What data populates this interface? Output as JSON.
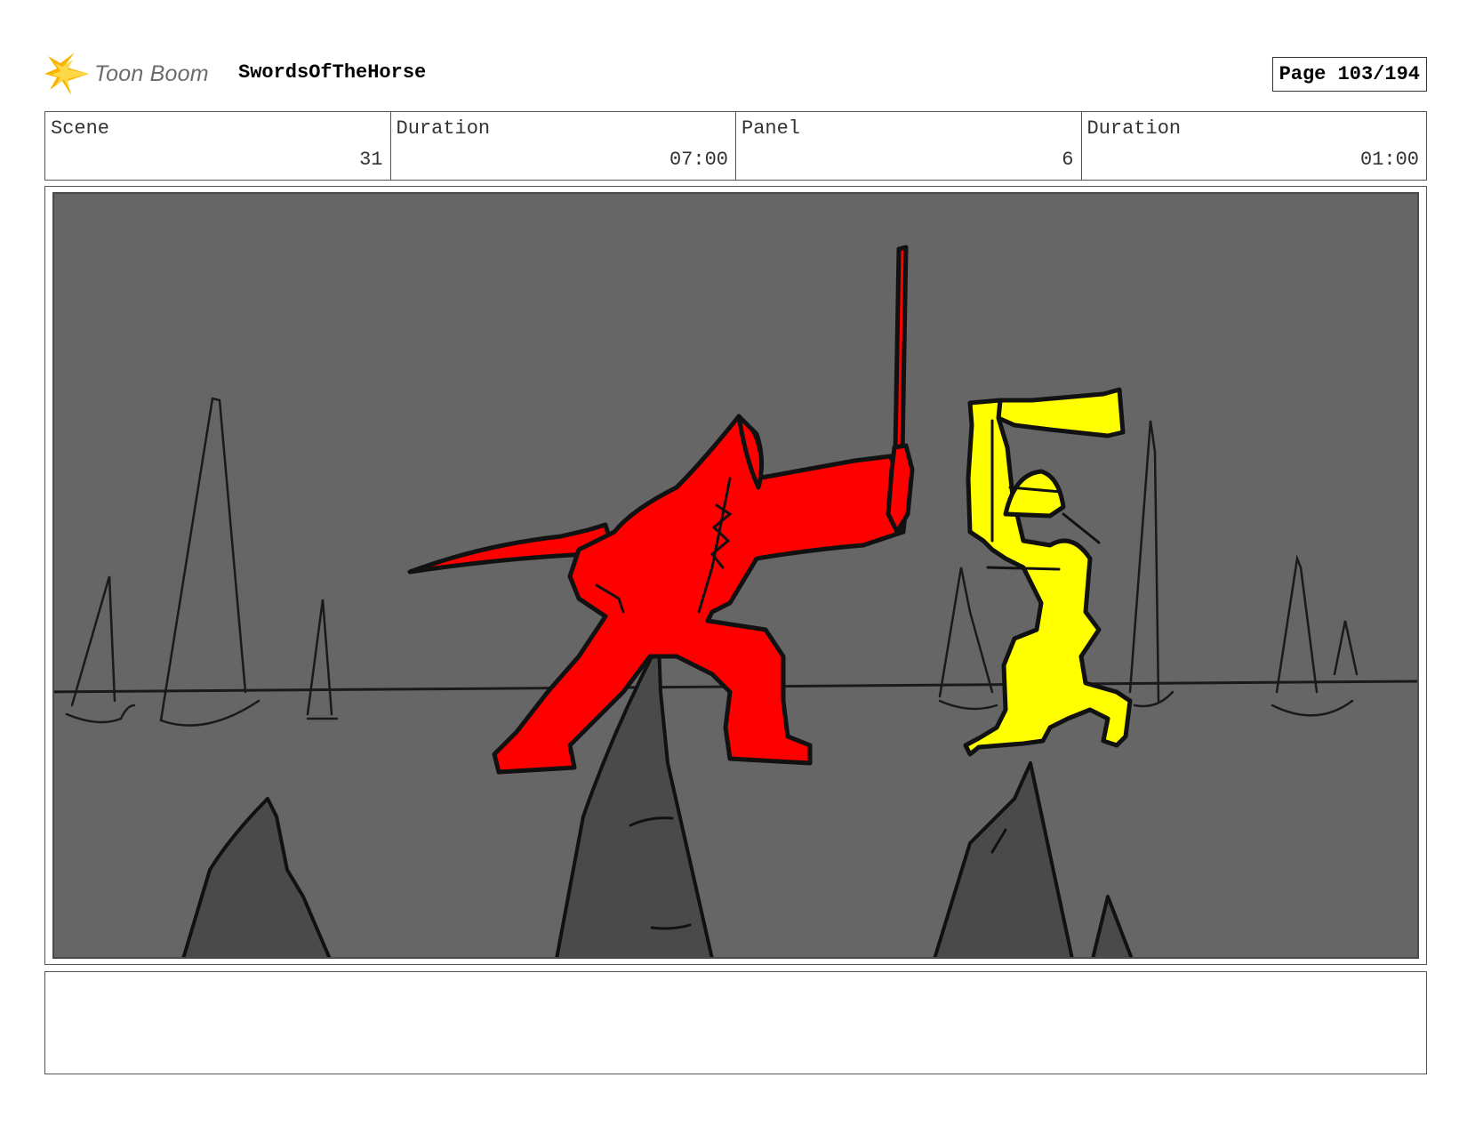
{
  "header": {
    "logo_text": "Toon Boom",
    "logo_icon": "starburst-icon",
    "project_title": "SwordsOfTheHorse",
    "page_label": "Page 103/194"
  },
  "info": {
    "scene_label": "Scene",
    "scene_value": "31",
    "scene_duration_label": "Duration",
    "scene_duration_value": "07:00",
    "panel_label": "Panel",
    "panel_value": "6",
    "panel_duration_label": "Duration",
    "panel_duration_value": "01:00"
  },
  "panel_image": {
    "background_color": "#666666",
    "red_figure_color": "#ff0000",
    "yellow_figure_color": "#ffff00",
    "rock_color": "#4a4a4a"
  },
  "notes": {
    "text": ""
  }
}
